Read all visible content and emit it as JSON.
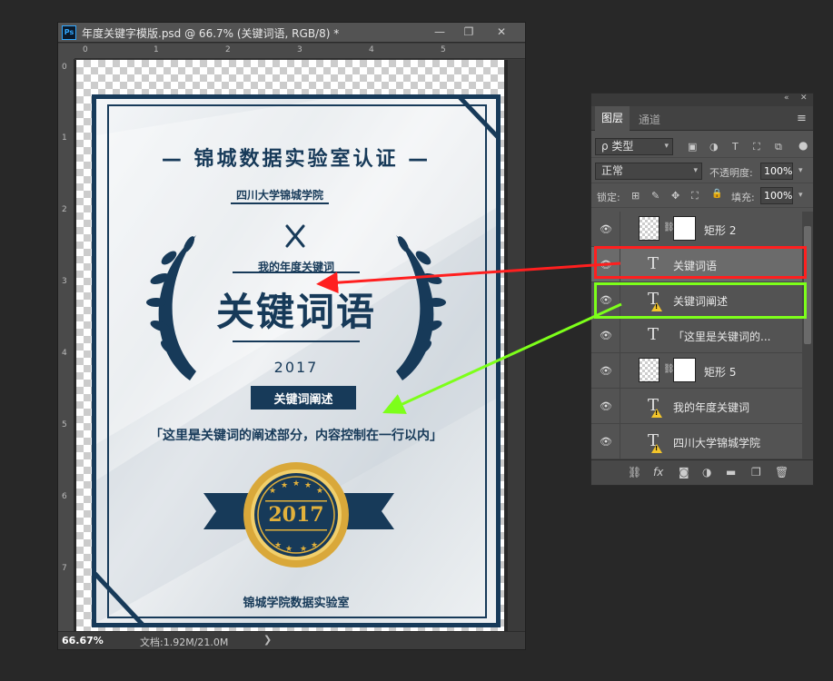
{
  "document": {
    "title": "年度关键字模版.psd @ 66.7% (关键词语, RGB/8) *",
    "app_icon": "Ps",
    "window_buttons": [
      "—",
      "❐",
      "✕"
    ],
    "ruler_top": [
      "0",
      "1",
      "2",
      "3",
      "4",
      "5"
    ],
    "ruler_left": [
      "0",
      "1",
      "2",
      "3",
      "4",
      "5",
      "6",
      "7"
    ],
    "zoom": "66.67%",
    "doc_size": "文档:1.92M/21.0M",
    "status_arrow": "❯"
  },
  "poster": {
    "title": "— 锦城数据实验室认证 —",
    "university": "四川大学锦城学院",
    "subtitle": "我的年度关键词",
    "keyword": "关键词语",
    "year": "2017",
    "desc_label": "关键词阐述",
    "desc_text": "「这里是关键词的阐述部分，内容控制在一行以内」",
    "seal_year": "2017",
    "footer": "锦城学院数据实验室",
    "colors": {
      "navy": "#173a59",
      "gold": "#e2b13c"
    }
  },
  "layers_panel": {
    "collapse_icon": "«",
    "close_icon": "✕",
    "tabs": [
      "图层",
      "通道"
    ],
    "menu_icon": "≡",
    "filter": {
      "label": "ρ 类型",
      "arrow": "▾",
      "icons": [
        "▣",
        "◑",
        "T",
        "⛶",
        "⧉"
      ],
      "toggle": "●"
    },
    "blend": {
      "mode": "正常",
      "opacity_label": "不透明度:",
      "opacity": "100%"
    },
    "lock": {
      "label": "锁定:",
      "icons": [
        "⊞",
        "✎",
        "✥",
        "⛶",
        "🔒"
      ],
      "fill_label": "填充:",
      "fill": "100%"
    },
    "layers": [
      {
        "name": "矩形 2",
        "type": "shape",
        "selected": false
      },
      {
        "name": "关键词语",
        "type": "text",
        "selected": true
      },
      {
        "name": "关键词阐述",
        "type": "text-warning",
        "selected": false
      },
      {
        "name": "「这里是关键词的...",
        "type": "text",
        "selected": false
      },
      {
        "name": "矩形 5",
        "type": "shape",
        "selected": false
      },
      {
        "name": "我的年度关键词",
        "type": "text-warning",
        "selected": false
      },
      {
        "name": "四川大学锦城学院",
        "type": "text-warning",
        "selected": false
      }
    ],
    "eye_icon": "👁",
    "text_thumb": "T",
    "link_icon": "⛓",
    "bottom_icons": [
      "⛓",
      "fx",
      "◙",
      "◑",
      "▬",
      "❐",
      "🗑"
    ]
  },
  "annotations": {
    "red_box_color": "#ff1f1f",
    "green_box_color": "#7dff1a"
  }
}
